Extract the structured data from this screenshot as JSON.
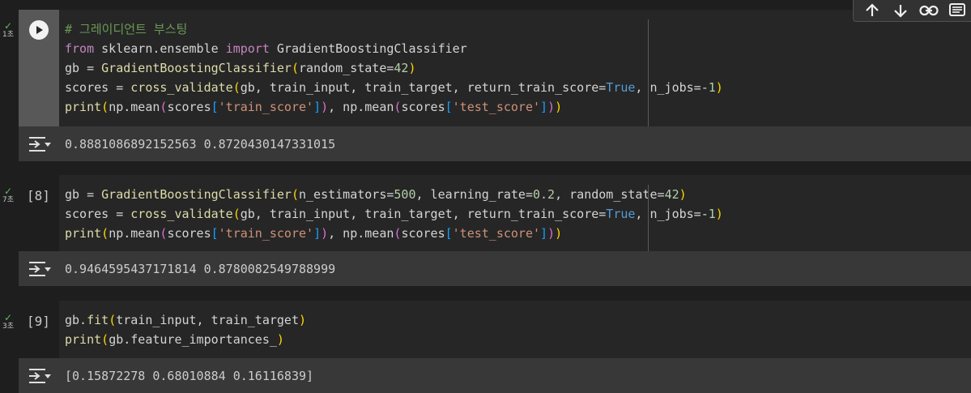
{
  "toolbar": {
    "icons": [
      "arrow-up-icon",
      "arrow-down-icon",
      "link-icon",
      "comment-icon"
    ]
  },
  "cells": [
    {
      "status_time": "1초",
      "run_label": "run",
      "code_lines": [
        "# 그레이디언트 부스팅",
        "from sklearn.ensemble import GradientBoostingClassifier",
        "gb = GradientBoostingClassifier(random_state=42)",
        "scores = cross_validate(gb, train_input, train_target, return_train_score=True, n_jobs=-1)",
        "print(np.mean(scores['train_score']), np.mean(scores['test_score']))"
      ],
      "output": "0.8881086892152563 0.8720430147331015"
    },
    {
      "status_time": "7초",
      "exec_count": "[8]",
      "code_lines": [
        "gb = GradientBoostingClassifier(n_estimators=500, learning_rate=0.2, random_state=42)",
        "scores = cross_validate(gb, train_input, train_target, return_train_score=True, n_jobs=-1)",
        "print(np.mean(scores['train_score']), np.mean(scores['test_score']))"
      ],
      "output": "0.9464595437171814 0.8780082549788999"
    },
    {
      "status_time": "3초",
      "exec_count": "[9]",
      "code_lines": [
        "gb.fit(train_input, train_target)",
        "print(gb.feature_importances_)"
      ],
      "output": "[0.15872278 0.68010884 0.16116839]"
    }
  ]
}
